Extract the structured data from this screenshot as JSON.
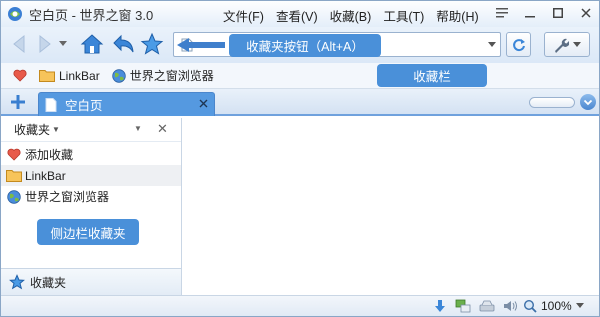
{
  "window": {
    "title": "空白页 - 世界之窗 3.0"
  },
  "menu": [
    "文件(F)",
    "查看(V)",
    "收藏(B)",
    "工具(T)",
    "帮助(H)"
  ],
  "annotations": {
    "favorites_button": "收藏夹按钮（Alt+A）",
    "bookmark_bar": "收藏栏",
    "sidebar_favorites": "侧边栏收藏夹"
  },
  "bookmarks_bar": {
    "items": [
      "LinkBar",
      "世界之窗浏览器"
    ]
  },
  "tabs": [
    {
      "label": "空白页"
    }
  ],
  "sidebar": {
    "title": "收藏夹",
    "items": [
      {
        "label": "添加收藏",
        "icon": "heart-icon"
      },
      {
        "label": "LinkBar",
        "icon": "folder-icon"
      },
      {
        "label": "世界之窗浏览器",
        "icon": "globe-icon"
      }
    ],
    "footer": "收藏夹"
  },
  "status": {
    "zoom": "100%"
  },
  "colors": {
    "accent": "#4a90d9",
    "tab": "#5599e0"
  }
}
